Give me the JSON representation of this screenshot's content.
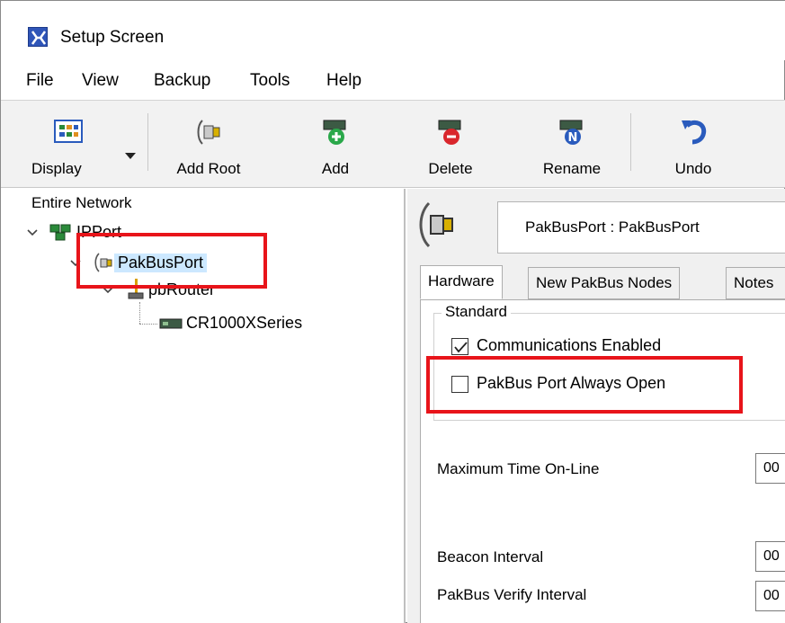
{
  "window": {
    "title": "Setup Screen"
  },
  "menu": [
    "File",
    "View",
    "Backup",
    "Tools",
    "Help"
  ],
  "toolbar": {
    "display": "Display",
    "add_root": "Add Root",
    "add": "Add",
    "delete": "Delete",
    "rename": "Rename",
    "undo": "Undo"
  },
  "tree": {
    "header": "Entire Network",
    "nodes": [
      {
        "label": "IPPort",
        "icon": "ipport-icon"
      },
      {
        "label": "PakBusPort",
        "icon": "pakbusport-icon",
        "selected": true
      },
      {
        "label": "pbRouter",
        "icon": "router-icon"
      },
      {
        "label": "CR1000XSeries",
        "icon": "datalogger-icon"
      }
    ]
  },
  "device": {
    "name": "PakBusPort : PakBusPort"
  },
  "tabs": [
    "Hardware",
    "New PakBus Nodes",
    "Notes"
  ],
  "hardware": {
    "group_title": "Standard",
    "communications_enabled": {
      "label": "Communications Enabled",
      "checked": true
    },
    "always_open": {
      "label": "PakBus Port Always Open",
      "checked": false
    },
    "max_time_online": {
      "label": "Maximum Time On-Line",
      "value": "00"
    },
    "beacon_interval": {
      "label": "Beacon Interval",
      "value": "00"
    },
    "verify_interval": {
      "label": "PakBus Verify Interval",
      "value": "00"
    }
  },
  "colors": {
    "highlight_box": "#e8141a",
    "selection": "#cce8ff",
    "toolbar_bg": "#f2f2f2"
  }
}
